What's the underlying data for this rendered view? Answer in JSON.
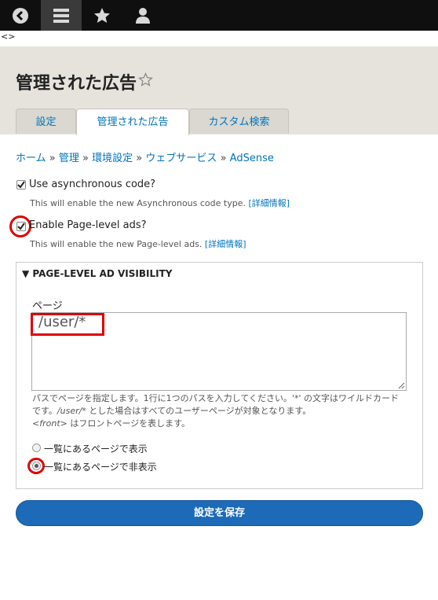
{
  "toolbar": {
    "items": [
      {
        "icon": "back-circle-icon"
      },
      {
        "icon": "menu-icon"
      },
      {
        "icon": "star-icon"
      },
      {
        "icon": "user-icon"
      }
    ]
  },
  "arrows": "<>",
  "page": {
    "title": "管理された広告"
  },
  "tabs": [
    {
      "label": "設定"
    },
    {
      "label": "管理された広告"
    },
    {
      "label": "カスタム検索"
    }
  ],
  "breadcrumb": {
    "items": [
      "ホーム",
      "管理",
      "環境設定",
      "ウェブサービス",
      "AdSense"
    ],
    "separator": "»"
  },
  "settings": {
    "async": {
      "label": "Use asynchronous code?",
      "description": "This will enable the new Asynchronous code type.",
      "more": "[詳細情報]",
      "checked": true
    },
    "pagelevel": {
      "label": "Enable Page-level ads?",
      "description": "This will enable the new Page-level ads.",
      "more": "[詳細情報]",
      "checked": true
    }
  },
  "visibility": {
    "legend": "PAGE-LEVEL AD VISIBILITY",
    "pages_label": "ページ",
    "pages_value": "/user/*",
    "help_1": "パスでページを指定します。1行に1つのパスを入力してください。'*' の文字はワイルドカードです。",
    "help_example": "/user/*",
    "help_2": " とした場合はすべてのユーザーページが対象となります。",
    "help_front": "<front>",
    "help_3": " はフロントページを表します。",
    "options": [
      {
        "label": "一覧にあるページで表示",
        "checked": false
      },
      {
        "label": "一覧にあるページで非表示",
        "checked": true
      }
    ]
  },
  "actions": {
    "save_label": "設定を保存"
  },
  "colors": {
    "link": "#0074bd",
    "toolbar_bg": "#0f0f0f",
    "header_bg": "#e5e3dc",
    "primary_button": "#1d6ab8",
    "highlight": "#e00000"
  }
}
